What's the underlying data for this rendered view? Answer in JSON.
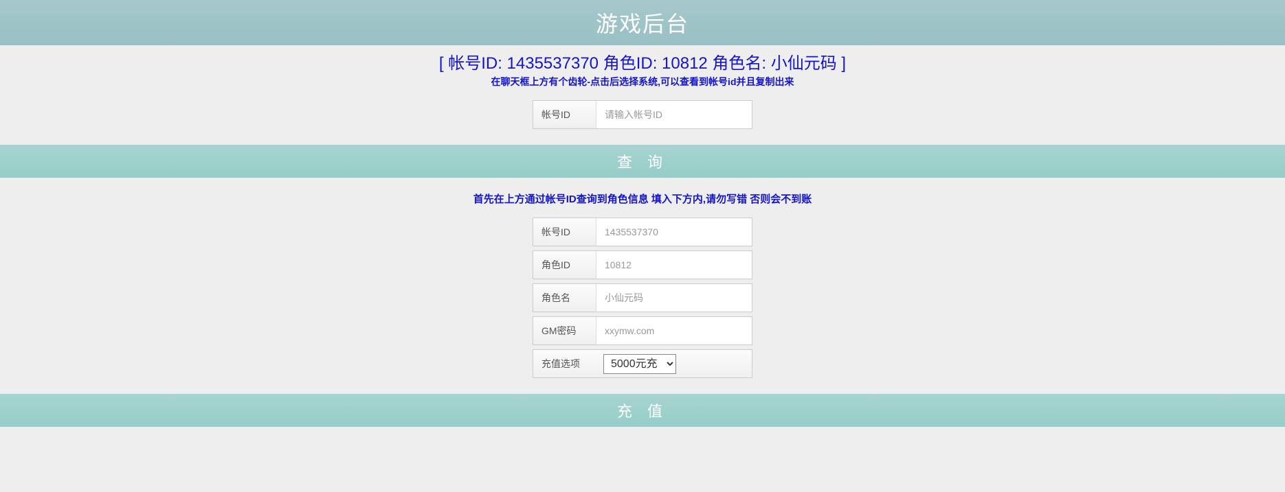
{
  "header": {
    "title": "游戏后台"
  },
  "account_info": {
    "display": "[ 帐号ID: 1435537370 角色ID: 10812 角色名: 小仙元码 ]"
  },
  "section1": {
    "help_text": "在聊天框上方有个齿轮-点击后选择系统,可以查看到帐号id并且复制出来",
    "account_id_label": "帐号ID",
    "account_id_placeholder": "请输入帐号ID",
    "query_button": "查 询"
  },
  "section2": {
    "help_text": "首先在上方通过帐号ID查询到角色信息 填入下方内,请勿写错 否则会不到账",
    "account_id_label": "帐号ID",
    "account_id_placeholder": "1435537370",
    "role_id_label": "角色ID",
    "role_id_placeholder": "10812",
    "role_name_label": "角色名",
    "role_name_placeholder": "小仙元码",
    "gm_password_label": "GM密码",
    "gm_password_placeholder": "xxymw.com",
    "recharge_option_label": "充值选项",
    "recharge_option_selected": "5000元充",
    "recharge_button": "充 值"
  }
}
